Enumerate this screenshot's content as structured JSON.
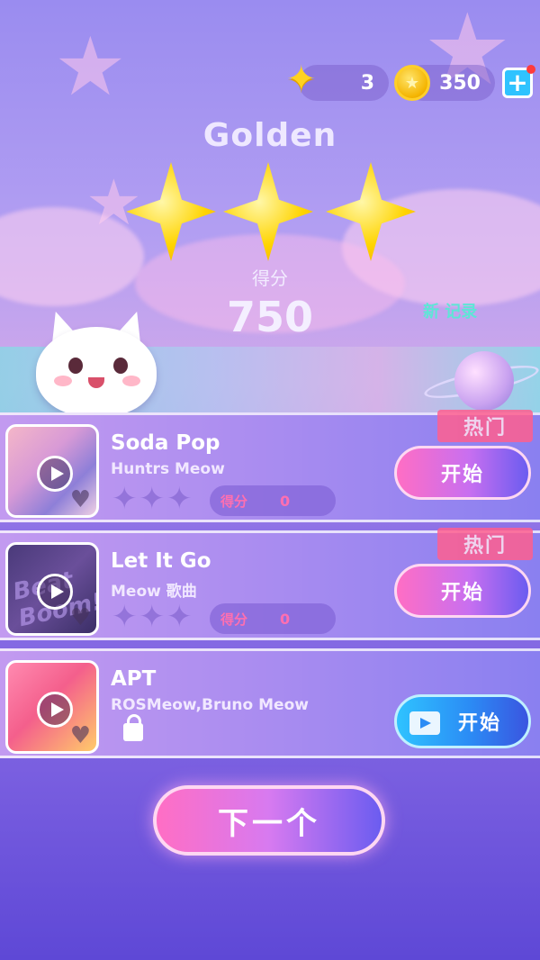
{
  "top_bar": {
    "stars_count": "3",
    "coins_count": "350",
    "plus_label": "+"
  },
  "result": {
    "level_title": "Golden",
    "stars_earned": 3,
    "score_label": "得分",
    "score_value": "750",
    "new_record": "新 记录"
  },
  "songs": [
    {
      "title": "Soda Pop",
      "artist": "Huntrs Meow",
      "score_label": "得分",
      "score": "0",
      "tag": "热门",
      "button": "开始",
      "locked": false
    },
    {
      "title": "Let It Go",
      "artist": "Meow 歌曲",
      "score_label": "得分",
      "score": "0",
      "tag": "热门",
      "button": "开始",
      "locked": false,
      "cover_text": "Beat Boom!"
    },
    {
      "title": "APT",
      "artist": "ROSMeow,Bruno Meow",
      "button": "开始",
      "locked": true
    }
  ],
  "next_button": "下一个",
  "colors": {
    "accent_pink": "#ff6ec4",
    "accent_blue": "#2fc3ff",
    "star_gold": "#ffd400",
    "record_teal": "#5ee6d6"
  }
}
